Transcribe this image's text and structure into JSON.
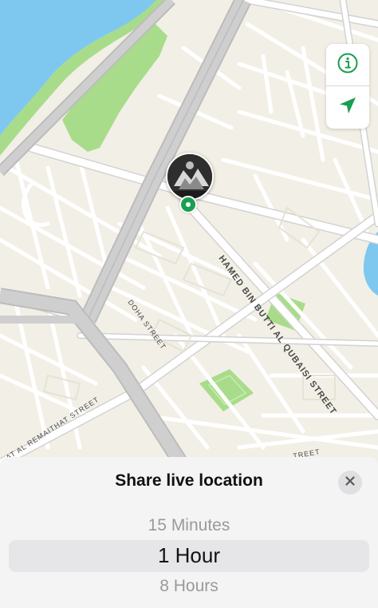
{
  "map": {
    "street_labels": {
      "hamed": "HAMED BIN BUTTI AL QUBAISI STREET",
      "doha": "DOHA STREET",
      "remaithat": "AT AL REMAITHAT STREET",
      "bottom_fragment": "TREET"
    },
    "controls": {
      "info_icon": "info-circle-icon",
      "locate_icon": "location-arrow-icon"
    },
    "colors": {
      "accent_green": "#1a9e52",
      "water": "#7ec8f0",
      "park": "#a8dc8a",
      "land": "#f2efe6",
      "road": "#ffffff",
      "highway": "#c8c8c8"
    }
  },
  "sheet": {
    "title": "Share live location",
    "close_icon": "close-x-icon",
    "options": {
      "previous": "15 Minutes",
      "selected": "1 Hour",
      "next": "8 Hours"
    }
  }
}
